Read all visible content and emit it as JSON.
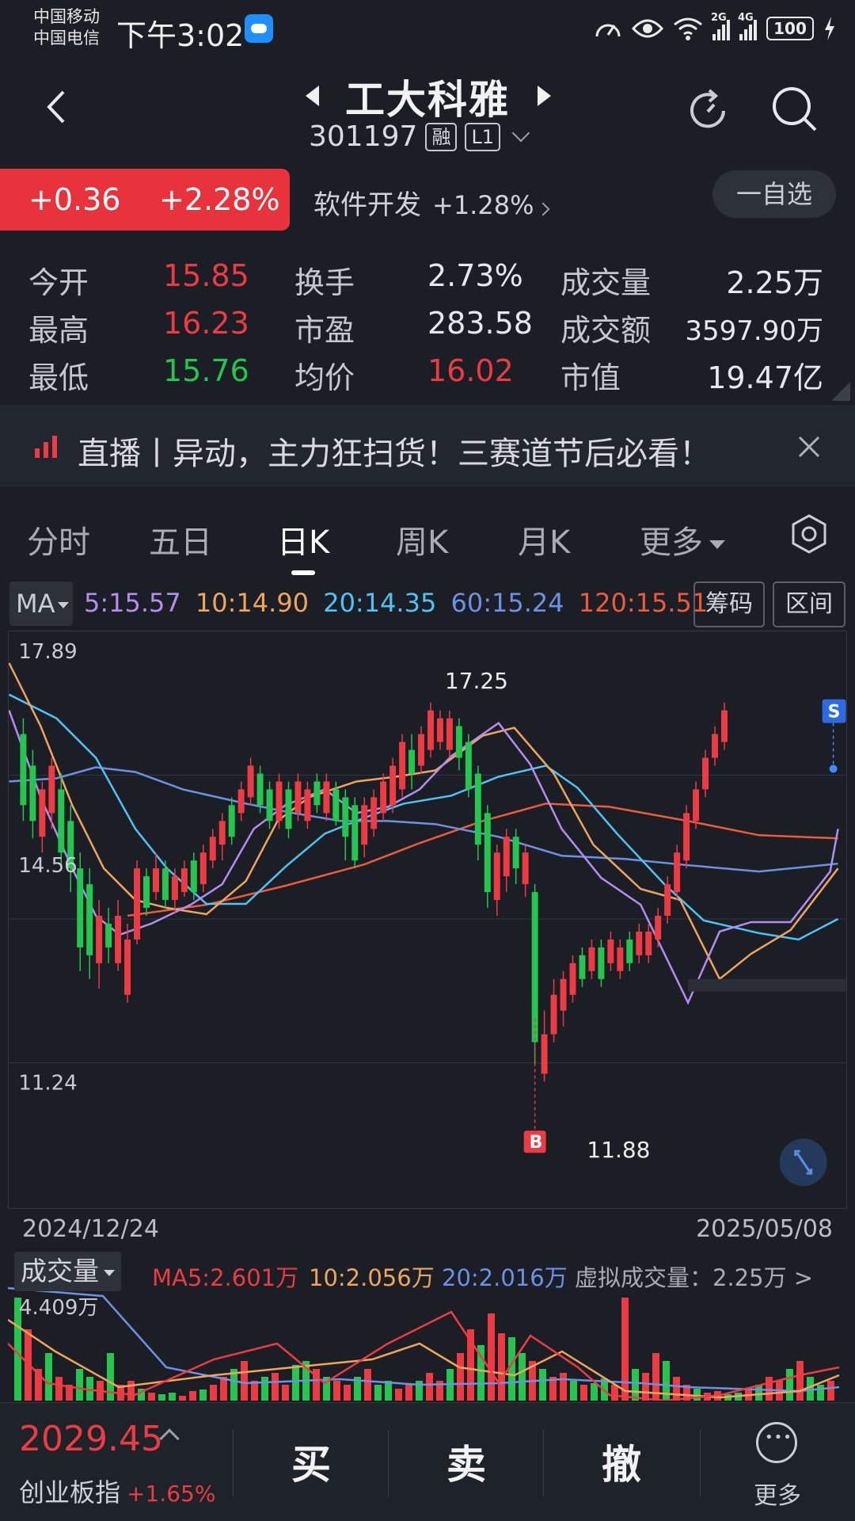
{
  "status": {
    "carrier1": "中国移动",
    "carrier2": "中国电信",
    "time": "下午3:02",
    "battery": "100",
    "net1": "2G",
    "net2": "4G"
  },
  "header": {
    "stock_name": "工大科雅",
    "stock_code": "301197",
    "tag_margin": "融",
    "tag_level": "L1"
  },
  "change": {
    "amount": "+0.36",
    "percent": "+2.28%",
    "sector_name": "软件开发",
    "sector_change": "+1.28%",
    "watch_button": "一自选"
  },
  "quote": {
    "open_label": "今开",
    "open_value": "15.85",
    "turnover_label": "换手",
    "turnover_value": "2.73%",
    "volume_label": "成交量",
    "volume_value": "2.25万",
    "high_label": "最高",
    "high_value": "16.23",
    "pe_label": "市盈",
    "pe_value": "283.58",
    "amount_label": "成交额",
    "amount_value": "3597.90万",
    "low_label": "最低",
    "low_value": "15.76",
    "avg_label": "均价",
    "avg_value": "16.02",
    "mcap_label": "市值",
    "mcap_value": "19.47亿"
  },
  "news": {
    "text": "直播丨异动，主力狂扫货！三赛道节后必看！"
  },
  "tabs": [
    "分时",
    "五日",
    "日K",
    "周K",
    "月K",
    "更多"
  ],
  "active_tab": "日K",
  "ma_bar": {
    "selector": "MA",
    "ma5": "5:15.57",
    "ma10": "10:14.90",
    "ma20": "20:14.35",
    "ma60": "60:15.24",
    "ma120": "120:15.51",
    "chips_button": "筹码",
    "range_button": "区间"
  },
  "kline": {
    "label_top": "17.89",
    "label_mid": "14.56",
    "label_bottom": "11.24",
    "label_high": "17.25",
    "label_low": "11.88",
    "buy_marker": "B",
    "sell_marker": "S",
    "date_start": "2024/12/24",
    "date_end": "2025/05/08"
  },
  "volume_bar": {
    "selector": "成交量",
    "ma5": "MA5:2.601万",
    "ma10": "10:2.056万",
    "ma20": "20:2.016万",
    "virtual": "虚拟成交量：2.25万 >",
    "max_label": "4.409万"
  },
  "bottom": {
    "index_value": "2029.45",
    "index_name": "创业板指",
    "index_change": "+1.65%",
    "buy": "买",
    "sell": "卖",
    "cancel": "撤",
    "more": "更多"
  },
  "colors": {
    "up": "#ee3b43",
    "down": "#24c64f",
    "ma5": "#b58cf0",
    "ma10": "#f0a45c",
    "ma20": "#4fc3f7",
    "ma60": "#6e90e6",
    "ma120": "#f05a3c"
  }
}
